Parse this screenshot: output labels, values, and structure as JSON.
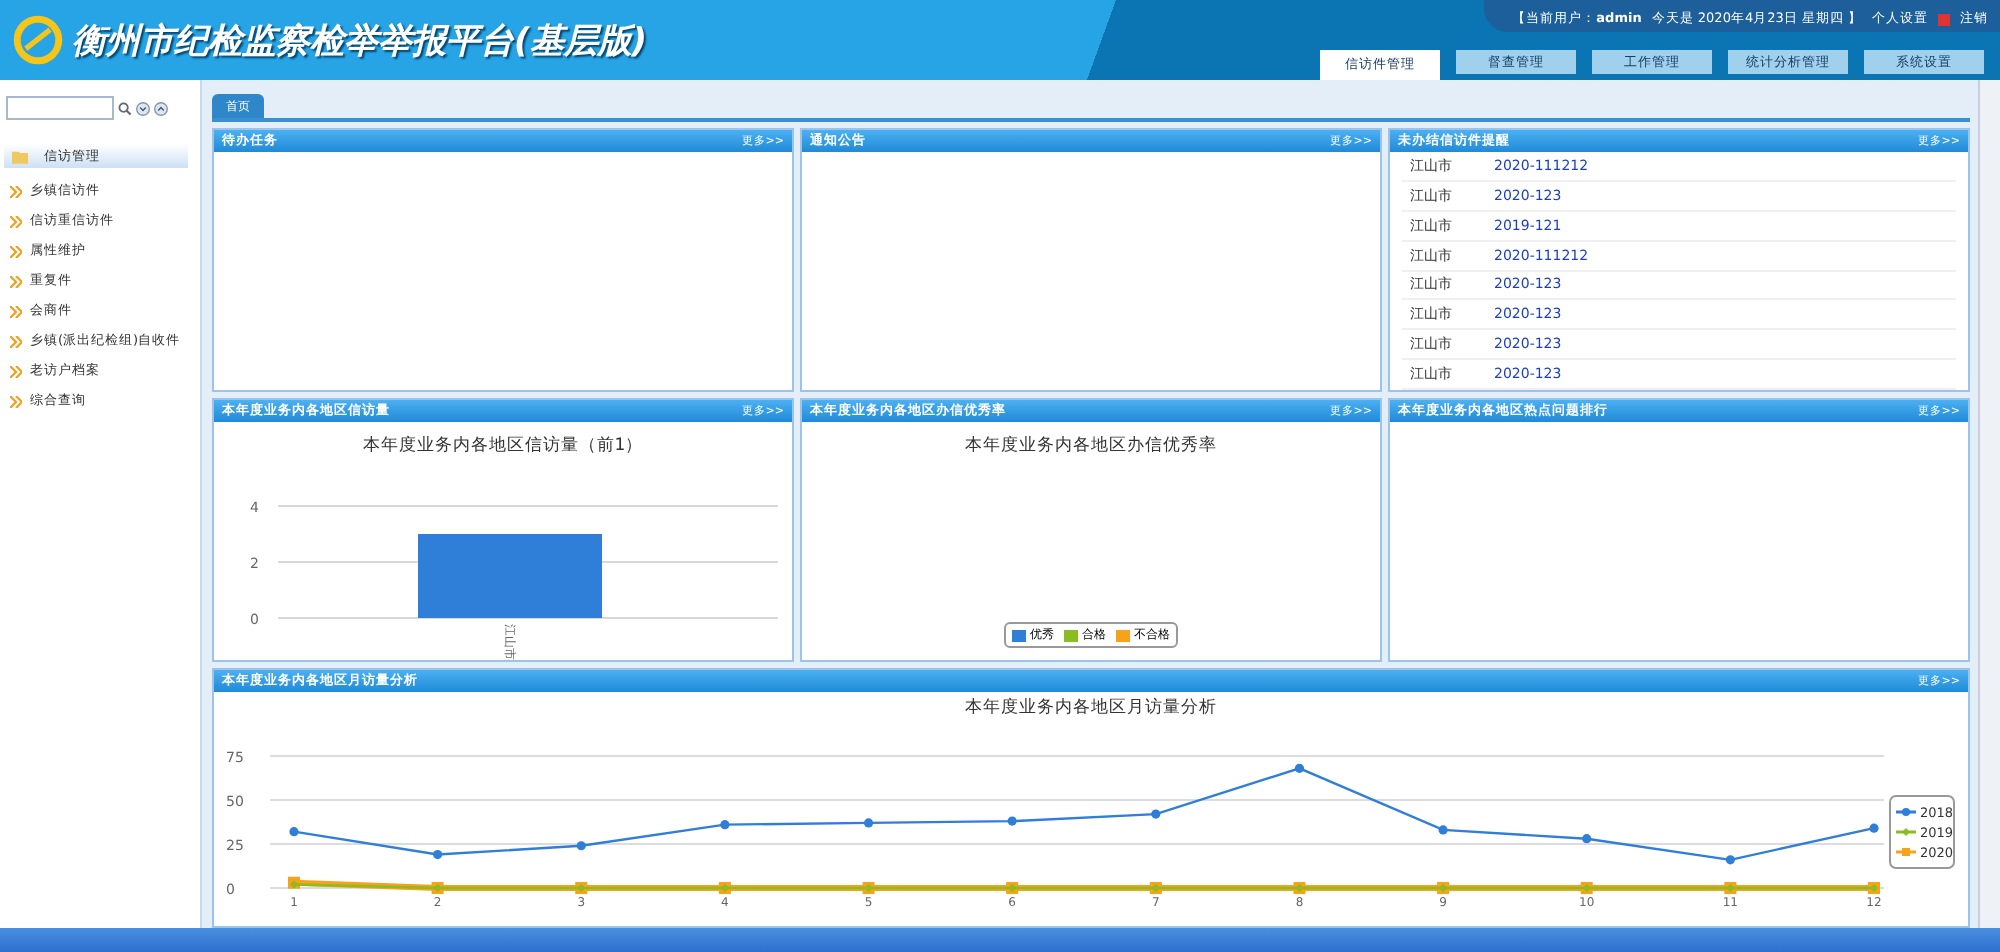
{
  "header": {
    "title": "衡州市纪检监察检举举报平台(基层版)",
    "user_prefix": "【当前用户：",
    "user": "admin",
    "date": "今天是 2020年4月23日 星期四 】",
    "settings": "个人设置",
    "logout": "注销"
  },
  "nav_tabs": [
    {
      "label": "信访件管理",
      "selected": true
    },
    {
      "label": "督查管理",
      "selected": false
    },
    {
      "label": "工作管理",
      "selected": false
    },
    {
      "label": "统计分析管理",
      "selected": false
    },
    {
      "label": "系统设置",
      "selected": false
    }
  ],
  "sidebar": {
    "group": "信访管理",
    "items": [
      "乡镇信访件",
      "信访重信访件",
      "属性维护",
      "重复件",
      "会商件",
      "乡镇(派出纪检组)自收件",
      "老访户档案",
      "综合查询"
    ]
  },
  "page_tab": "首页",
  "panels": [
    {
      "kind": "empty",
      "title": "待办任务",
      "more": "更多>>"
    },
    {
      "kind": "empty",
      "title": "通知公告",
      "more": "更多>>"
    },
    {
      "kind": "list",
      "title": "未办结信访件提醒",
      "more": "更多>>",
      "rows": [
        {
          "region": "江山市",
          "code": "2020-111212"
        },
        {
          "region": "江山市",
          "code": "2020-123"
        },
        {
          "region": "江山市",
          "code": "2019-121"
        },
        {
          "region": "江山市",
          "code": "2020-111212"
        },
        {
          "region": "江山市",
          "code": "2020-123"
        },
        {
          "region": "江山市",
          "code": "2020-123"
        },
        {
          "region": "江山市",
          "code": "2020-123"
        },
        {
          "region": "江山市",
          "code": "2020-123"
        }
      ]
    },
    {
      "kind": "bar",
      "title": "本年度业务内各地区信访量",
      "more": "更多>>",
      "chart_data": {
        "type": "bar",
        "title": "本年度业务内各地区信访量（前1）",
        "categories": [
          "江山市"
        ],
        "series": [
          {
            "color": "#2f7ed8",
            "values": [
              3
            ]
          }
        ],
        "yticks": [
          0,
          2,
          4
        ],
        "ylim": [
          0,
          4
        ]
      }
    },
    {
      "kind": "rate",
      "title": "本年度业务内各地区办信优秀率",
      "more": "更多>>",
      "chart_title": "本年度业务内各地区办信优秀率",
      "legend": [
        {
          "label": "优秀",
          "color": "#2f7ed8"
        },
        {
          "label": "合格",
          "color": "#8bbc21"
        },
        {
          "label": "不合格",
          "color": "#f7a21b"
        }
      ]
    },
    {
      "kind": "empty",
      "title": "本年度业务内各地区热点问题排行",
      "more": "更多>>"
    }
  ],
  "monthly": {
    "title": "本年度业务内各地区月访量分析",
    "more": "更多>>",
    "chart_data": {
      "type": "line",
      "title": "本年度业务内各地区月访量分析",
      "x": [
        "1",
        "2",
        "3",
        "4",
        "5",
        "6",
        "7",
        "8",
        "9",
        "10",
        "11",
        "12"
      ],
      "yticks": [
        0,
        25,
        50,
        75
      ],
      "ylim": [
        0,
        75
      ],
      "legend": true,
      "series": [
        {
          "name": "2018",
          "color": "#2f7ed8",
          "marker": "circle",
          "values": [
            32,
            19,
            24,
            36,
            37,
            38,
            42,
            68,
            33,
            28,
            16,
            34
          ]
        },
        {
          "name": "2019",
          "color": "#8bbc21",
          "marker": "diamond",
          "values": [
            2,
            0,
            0,
            0,
            0,
            0,
            0,
            0,
            0,
            0,
            0,
            0
          ]
        },
        {
          "name": "2020",
          "color": "#f7a21b",
          "marker": "square",
          "values": [
            3,
            0,
            0,
            0,
            0,
            0,
            0,
            0,
            0,
            0,
            0,
            0
          ]
        }
      ]
    }
  }
}
